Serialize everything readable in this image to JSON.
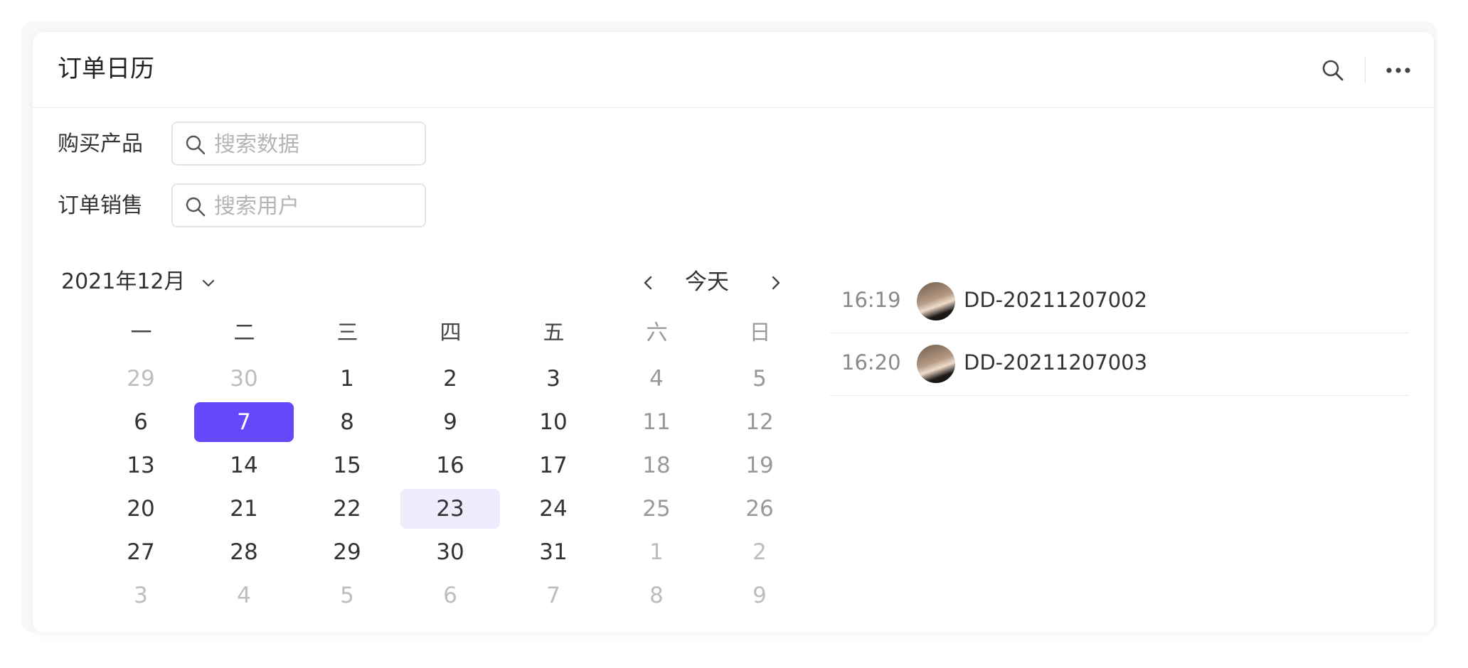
{
  "header": {
    "title": "订单日历",
    "search_icon": "search-icon",
    "more_icon": "more-horizontal-icon"
  },
  "filters": [
    {
      "label": "购买产品",
      "placeholder": "搜索数据",
      "value": ""
    },
    {
      "label": "订单销售",
      "placeholder": "搜索用户",
      "value": ""
    }
  ],
  "calendar": {
    "month_label": "2021年12月",
    "today_label": "今天",
    "weekdays": [
      "一",
      "二",
      "三",
      "四",
      "五",
      "六",
      "日"
    ],
    "selected_day": "7",
    "today_day": "23",
    "weeks": [
      [
        "29",
        "30",
        "1",
        "2",
        "3",
        "4",
        "5"
      ],
      [
        "6",
        "7",
        "8",
        "9",
        "10",
        "11",
        "12"
      ],
      [
        "13",
        "14",
        "15",
        "16",
        "17",
        "18",
        "19"
      ],
      [
        "20",
        "21",
        "22",
        "23",
        "24",
        "25",
        "26"
      ],
      [
        "27",
        "28",
        "29",
        "30",
        "31",
        "1",
        "2"
      ],
      [
        "3",
        "4",
        "5",
        "6",
        "7",
        "8",
        "9"
      ]
    ],
    "accent_color": "#6448fb",
    "today_bg_color": "#eeecfd"
  },
  "events": [
    {
      "time": "16:19",
      "order": "DD-20211207002"
    },
    {
      "time": "16:20",
      "order": "DD-20211207003"
    }
  ]
}
